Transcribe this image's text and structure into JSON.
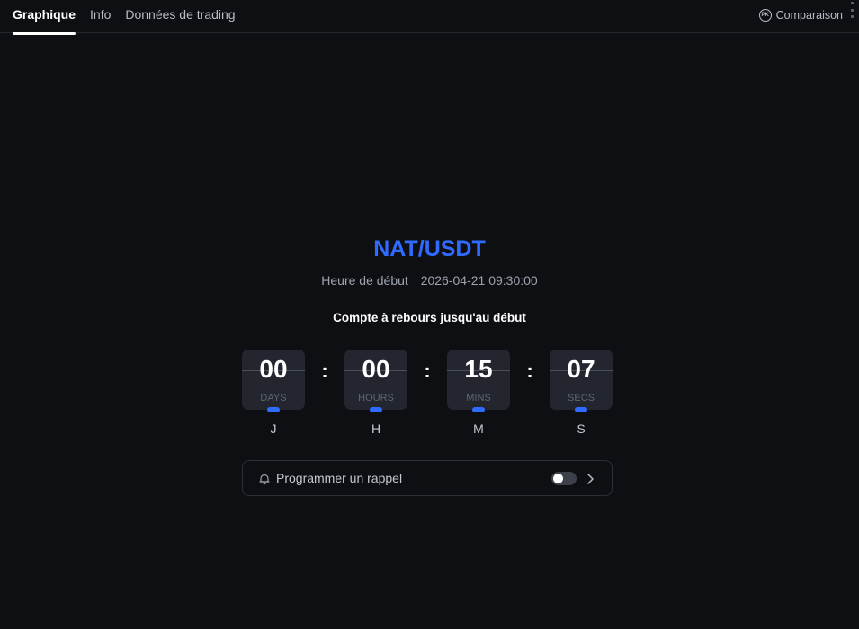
{
  "tabs": [
    {
      "label": "Graphique",
      "active": true
    },
    {
      "label": "Info",
      "active": false
    },
    {
      "label": "Données de trading",
      "active": false
    }
  ],
  "compare": {
    "icon_text": "PK",
    "label": "Comparaison"
  },
  "pair": "NAT/USDT",
  "start": {
    "label": "Heure de début",
    "value": "2026-04-21 09:30:00"
  },
  "countdown": {
    "title": "Compte à rebours jusqu'au début",
    "units": [
      {
        "value": "00",
        "label": "DAYS",
        "letter": "J"
      },
      {
        "value": "00",
        "label": "HOURS",
        "letter": "H"
      },
      {
        "value": "15",
        "label": "MINS",
        "letter": "M"
      },
      {
        "value": "07",
        "label": "SECS",
        "letter": "S"
      }
    ],
    "separator": ":"
  },
  "reminder": {
    "label": "Programmer un rappel",
    "enabled": false
  },
  "colors": {
    "accent": "#2f6bff",
    "background": "#0e0f13",
    "card": "#23262e"
  }
}
